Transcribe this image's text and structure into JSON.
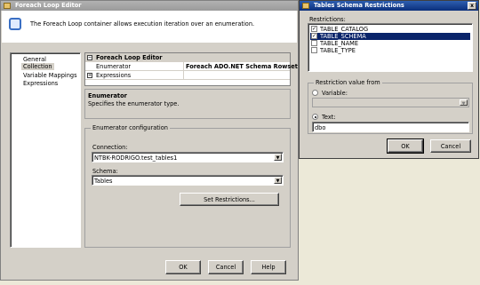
{
  "foreach_editor": {
    "title": "Foreach Loop Editor",
    "description": "The Foreach Loop container allows execution iteration over an enumeration.",
    "nav": [
      "General",
      "Collection",
      "Variable Mappings",
      "Expressions"
    ],
    "grid": {
      "category": "Foreach Loop Editor",
      "rows": [
        {
          "name": "Enumerator",
          "value": "Foreach ADO.NET Schema Rowset En"
        },
        {
          "name": "Expressions",
          "value": ""
        }
      ]
    },
    "info": {
      "title": "Enumerator",
      "text": "Specifies the enumerator type."
    },
    "config": {
      "group_label": "Enumerator configuration",
      "connection_label": "Connection:",
      "connection_value": "NTBK-RODRIGO.test_tables1",
      "schema_label": "Schema:",
      "schema_value": "Tables",
      "set_restrictions": "Set Restrictions..."
    },
    "buttons": {
      "ok": "OK",
      "cancel": "Cancel",
      "help": "Help"
    }
  },
  "restrictions_dialog": {
    "title": "Tables Schema Restrictions",
    "restrictions_label": "Restrictions:",
    "items": [
      {
        "label": "TABLE_CATALOG",
        "checked": true
      },
      {
        "label": "TABLE_SCHEMA",
        "checked": true
      },
      {
        "label": "TABLE_NAME",
        "checked": false
      },
      {
        "label": "TABLE_TYPE",
        "checked": false
      }
    ],
    "value_group_label": "Restriction value from",
    "variable_label": "Variable:",
    "text_label": "Text:",
    "text_value": "dbo",
    "ok": "OK",
    "cancel": "Cancel"
  },
  "colors": {
    "selection": "#0a246a",
    "active_title": "#0a2f7c"
  }
}
